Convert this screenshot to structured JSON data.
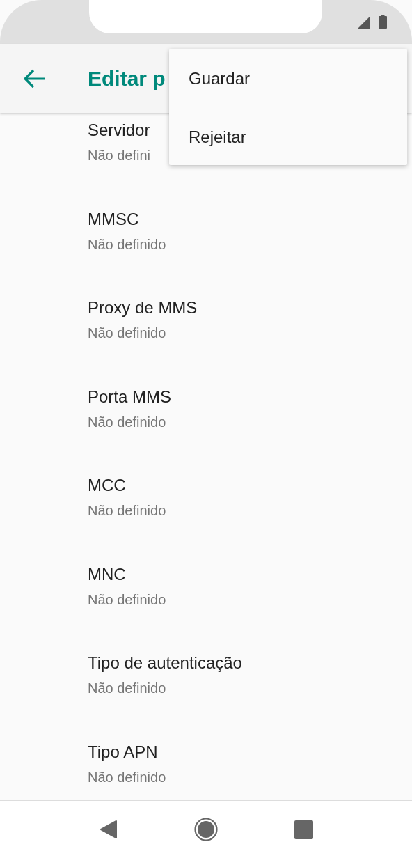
{
  "app_bar": {
    "title": "Editar p"
  },
  "settings": [
    {
      "title": "Servidor",
      "summary": "Não defini"
    },
    {
      "title": "MMSC",
      "summary": "Não definido"
    },
    {
      "title": "Proxy de MMS",
      "summary": "Não definido"
    },
    {
      "title": "Porta MMS",
      "summary": "Não definido"
    },
    {
      "title": "MCC",
      "summary": "Não definido"
    },
    {
      "title": "MNC",
      "summary": "Não definido"
    },
    {
      "title": "Tipo de autenticação",
      "summary": "Não definido"
    },
    {
      "title": "Tipo APN",
      "summary": "Não definido"
    }
  ],
  "menu": {
    "items": [
      "Guardar",
      "Rejeitar"
    ]
  }
}
